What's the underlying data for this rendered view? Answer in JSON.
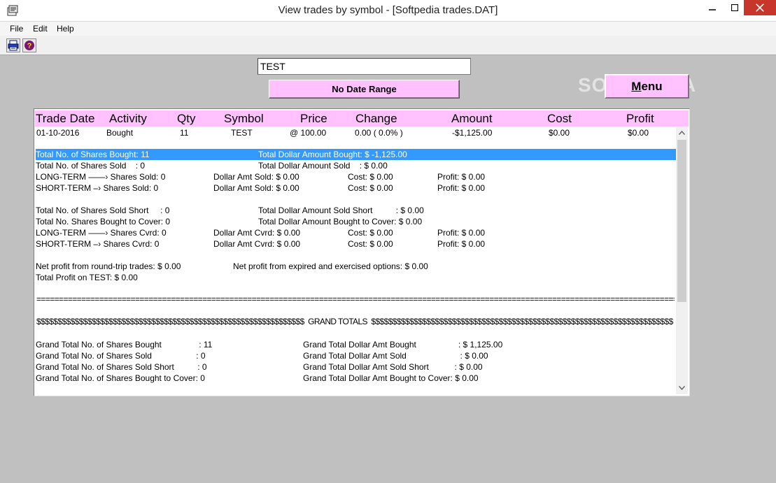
{
  "window": {
    "title": "View trades by symbol - [Softpedia trades.DAT]"
  },
  "menubar": {
    "file": "File",
    "edit": "Edit",
    "help": "Help"
  },
  "toolbar": {
    "print_icon": "printer-icon",
    "help_icon": "help-icon"
  },
  "symbol_input": {
    "value": "TEST"
  },
  "date_range_label": "No Date Range",
  "menu_button": {
    "label_first": "M",
    "label_rest": "enu"
  },
  "watermark": "SOFTPEDIA",
  "columns": [
    "Trade Date",
    "Activity",
    "Qty",
    "Symbol",
    "Price",
    "Change",
    "Amount",
    "Cost",
    "Profit"
  ],
  "trade": {
    "date": "01-10-2016",
    "activity": "Bought",
    "qty": "11",
    "symbol": "TEST",
    "price": "@  100.00",
    "change": "0.00 ( 0.0% )",
    "amount": "-$1,125.00",
    "cost": "$0.00",
    "profit": "$0.00"
  },
  "summary": {
    "bought_left": "Total No. of Shares Bought: 11",
    "bought_right": "Total Dollar Amount Bought: $ -1,125.00",
    "sold_left": "Total No. of Shares Sold    : 0",
    "sold_right": "Total Dollar Amount Sold    : $ 0.00",
    "lt_sold": "LONG-TERM ——› Shares Sold: 0",
    "lt_sold_amt": "Dollar Amt Sold: $ 0.00",
    "lt_sold_cost": "Cost: $ 0.00",
    "lt_sold_profit": "Profit: $ 0.00",
    "st_sold": "SHORT-TERM –› Shares Sold: 0",
    "st_sold_amt": "Dollar Amt Sold: $ 0.00",
    "st_sold_cost": "Cost: $ 0.00",
    "st_sold_profit": "Profit: $ 0.00",
    "short_left": "Total No. of Shares Sold Short     : 0",
    "short_right": "Total Dollar Amount Sold Short          : $ 0.00",
    "cover_left": "Total No. Shares Bought to Cover: 0",
    "cover_right": "Total Dollar Amount Bought to Cover: $ 0.00",
    "lt_cvrd": "LONG-TERM ——› Shares Cvrd: 0",
    "lt_cvrd_amt": "Dollar Amt Cvrd: $ 0.00",
    "lt_cvrd_cost": "Cost: $ 0.00",
    "lt_cvrd_profit": "Profit: $ 0.00",
    "st_cvrd": "SHORT-TERM –› Shares Cvrd: 0",
    "st_cvrd_amt": "Dollar Amt Cvrd: $ 0.00",
    "st_cvrd_cost": "Cost: $ 0.00",
    "st_cvrd_profit": "Profit: $ 0.00",
    "net_roundtrip": "Net profit from round-trip trades: $ 0.00",
    "net_options": "Net profit from expired and exercised options: $ 0.00",
    "total_profit": "Total Profit on TEST: $ 0.00",
    "separator": "=================================================================================================================================================================================",
    "grand_banner": "$$$$$$$$$$$$$$$$$$$$$$$$$$$$$$$$$$$$$$$$$$$$$$$$$$$$$$$$$$$$$$$  GRAND TOTALS  $$$$$$$$$$$$$$$$$$$$$$$$$$$$$$$$$$$$$$$$$$$$$$$$$$$$$$$$$$$$$$$$$$$$$$$",
    "gt_bought_left": "Grand Total No. of Shares Bought                : 11",
    "gt_bought_right": "Grand Total Dollar Amt Bought                  : $ 1,125.00",
    "gt_sold_left": "Grand Total No. of Shares Sold                   : 0",
    "gt_sold_right": "Grand Total Dollar Amt Sold                       : $ 0.00",
    "gt_short_left": "Grand Total No. of Shares Sold Short          : 0",
    "gt_short_right": "Grand Total Dollar Amt Sold Short           : $ 0.00",
    "gt_cover_left": "Grand Total No. of Shares Bought to Cover: 0",
    "gt_cover_right": "Grand Total Dollar Amt Bought to Cover: $ 0.00"
  },
  "colors": {
    "pink": "#ffc2ff",
    "selection": "#3399ff",
    "background": "#c0c0c0"
  }
}
